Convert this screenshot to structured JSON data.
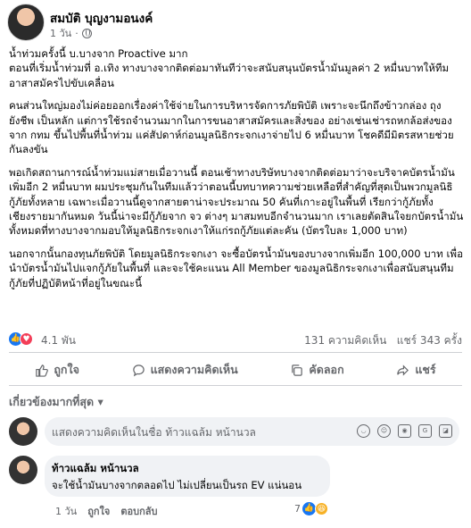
{
  "post": {
    "author": "สมบัติ บุญงามอนงค์",
    "time": "1 วัน",
    "paragraphs": [
      "น้ำท่วมครั้งนี้ บ.บางจาก Proactive มาก\nตอนที่เริ่มน้ำท่วมที่ อ.เทิง ทางบางจากติดต่อมาทันทีว่าจะสนับสนุนบัตรน้ำมันมูลค่า 2 หมื่นบาทให้ทีมอาสาสมัครไปขับเคลื่อน",
      "คนส่วนใหญ่มองไม่ค่อยออกเรื่องค่าใช้จ่ายในการบริหารจัดการภัยพิบัติ เพราะจะนึกถึงข้าวกล่อง ถุงยังชีพ เป็นหลัก แต่การใช้รถจำนวนมากในการขนอาสาสมัครและสิ่งของ อย่างเช่นเช่ารถหกล้อส่งของจาก กทม ขึ้นไปพื้นที่น้ำท่วม แค่สัปดาห์ก่อนมูลนิธิกระจกเงาจ่ายไป 6 หมื่นบาท โชคดีมีมิตรสหายช่วยกันลงขัน",
      "พอเกิดสถานการณ์น้ำท่วมแม่สายเมื่อวานนี้ ตอนเช้าทางบริษัทบางจากติดต่อมาว่าจะบริจาคบัตรน้ำมันเพิ่มอีก 2 หมื่นบาท ผมประชุมกันในทีมแล้วว่าตอนนี้บทบาทความช่วยเหลือที่สำคัญที่สุดเป็นพวกมูลนิธิกู้ภัยทั้งหลาย เฉพาะเมื่อวานนี้ดูจากสายตาน่าจะประมาณ 50 คันที่เกาะอยู่ในพื้นที่ เรียกว่ากู้ภัยทั้งเชียงรายมากันหมด วันนี้น่าจะมีกู้ภัยจาก จว ต่างๆ มาสมทบอีกจำนวนมาก เราเลยตัดสินใจยกบัตรน้ำมันทั้งหมดที่ทางบางจากมอบให้มูลนิธิกระจกเงาให้แก่รถกู้ภัยแต่ละคัน (บัตรใบละ 1,000 บาท)",
      "นอกจากนั้นกองทุนภัยพิบัติ โดยมูลนิธิกระจกเงา จะซื้อบัตรน้ำมันของบางจากเพิ่มอีก 100,000 บาท เพื่อนำบัตรน้ำมันไปแจกกู้ภัยในพื้นที่ และจะใช้คะแนน All Member ของมูลนิธิกระจกเงาเพื่อสนับสนุนทีมกู้ภัยที่ปฏิบัติหน้าที่อยู่ในขณะนี้"
    ]
  },
  "reactions": {
    "count": "4.1 พัน",
    "comments": "131 ความคิดเห็น",
    "shares": "แชร์ 343 ครั้ง"
  },
  "actions": {
    "like": "ถูกใจ",
    "comment": "แสดงความคิดเห็น",
    "copy": "คัดลอก",
    "share": "แชร์"
  },
  "sort_label": "เกี่ยวข้องมากที่สุด",
  "comment_box": {
    "placeholder": "แสดงความคิดเห็นในชื่อ ท้าวแฉล้ม หน้านวล"
  },
  "comment": {
    "author": "ท้าวแฉล้ม หน้านวล",
    "text": "จะใช้น้ำมันบางจากตลอดไป ไม่เปลี่ยนเป็นรถ EV แน่นอน",
    "time": "1 วัน",
    "like": "ถูกใจ",
    "reply": "ตอบกลับ",
    "reaction_count": "7"
  },
  "colors": {
    "accent": "#1877f2",
    "love": "#f33e58",
    "muted": "#65676b"
  }
}
